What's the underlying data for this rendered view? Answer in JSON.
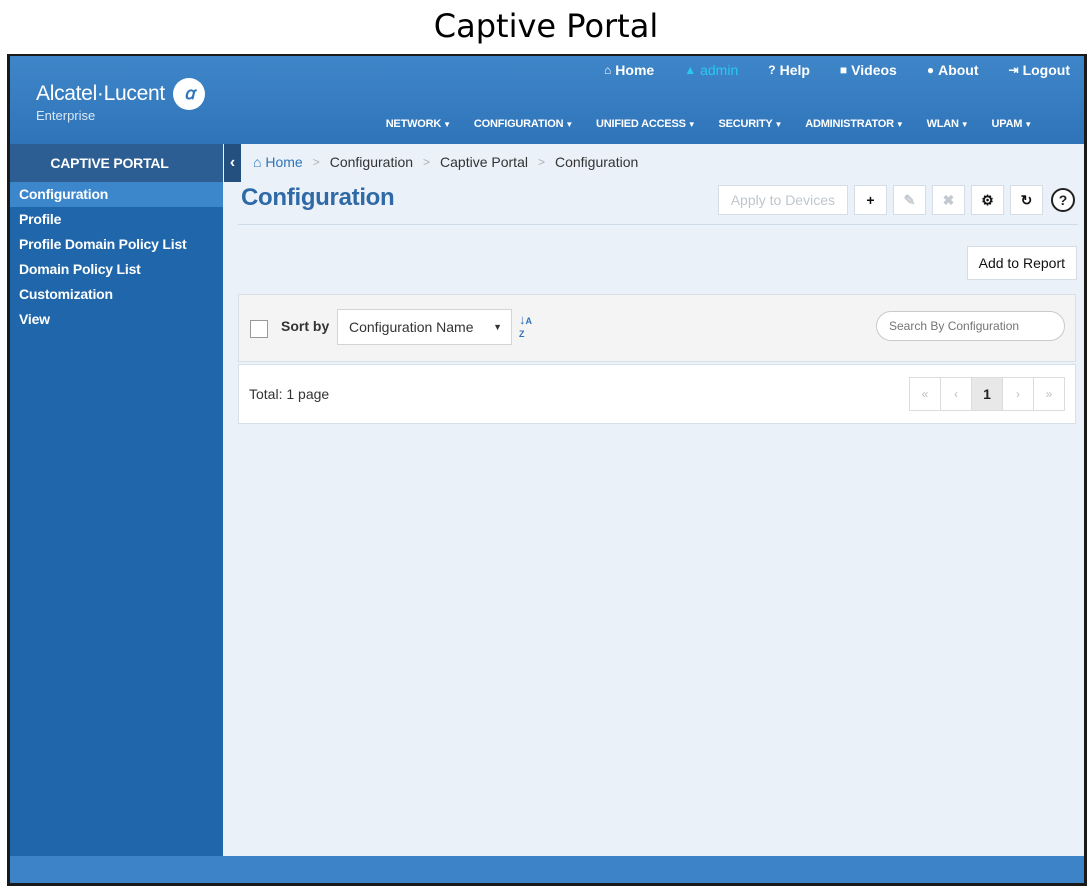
{
  "caption": "Captive Portal",
  "brand": {
    "name": "Alcatel·Lucent",
    "mark": "ꭤ",
    "sub": "Enterprise"
  },
  "toplinks": [
    {
      "icon": "home-icon",
      "glyph": "⌂",
      "label": "Home"
    },
    {
      "icon": "user-icon",
      "glyph": "▲",
      "label": "admin"
    },
    {
      "icon": "question-icon",
      "glyph": "?",
      "label": "Help"
    },
    {
      "icon": "video-icon",
      "glyph": "■",
      "label": "Videos"
    },
    {
      "icon": "info-icon",
      "glyph": "●",
      "label": "About"
    },
    {
      "icon": "logout-icon",
      "glyph": "⇥",
      "label": "Logout"
    }
  ],
  "nav": [
    "NETWORK",
    "CONFIGURATION",
    "UNIFIED ACCESS",
    "SECURITY",
    "ADMINISTRATOR",
    "WLAN",
    "UPAM"
  ],
  "sidebar": {
    "title": "CAPTIVE PORTAL",
    "items": [
      "Configuration",
      "Profile",
      "Profile Domain Policy List",
      "Domain Policy List",
      "Customization",
      "View"
    ],
    "active_index": 0
  },
  "breadcrumb": {
    "home": "Home",
    "items": [
      "Configuration",
      "Captive Portal",
      "Configuration"
    ]
  },
  "page_title": "Configuration",
  "toolbar": {
    "apply_label": "Apply to Devices",
    "add": "+",
    "edit": "✎",
    "delete": "✖",
    "settings": "⚙",
    "refresh": "↻",
    "help": "?"
  },
  "report_label": "Add to Report",
  "filter": {
    "sort_label": "Sort by",
    "sort_value": "Configuration Name",
    "search_placeholder": "Search By Configuration"
  },
  "paging": {
    "total": "Total: 1 page",
    "first": "«",
    "prev": "‹",
    "current": "1",
    "next": "›",
    "last": "»"
  },
  "colors": {
    "header": "#2f74b8",
    "sidebar": "#1f66aa",
    "active": "#3c86cc",
    "title": "#2f6aa6",
    "admin": "#29c9f0"
  }
}
